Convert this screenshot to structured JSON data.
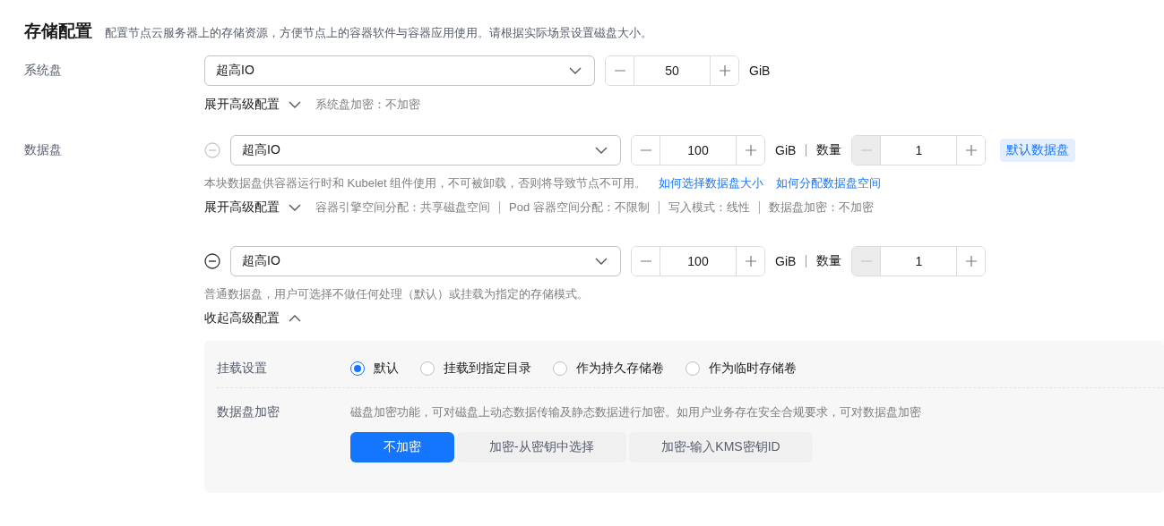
{
  "section": {
    "title": "存储配置",
    "description": "配置节点云服务器上的存储资源，方便节点上的容器软件与容器应用使用。请根据实际场景设置磁盘大小。"
  },
  "system_disk": {
    "label": "系统盘",
    "type": "超高IO",
    "size": "50",
    "unit": "GiB",
    "advanced_toggle": {
      "label": "展开高级配置",
      "expanded": false
    },
    "summary": [
      "系统盘加密：不加密"
    ]
  },
  "data_disk_label": "数据盘",
  "data_disks": [
    {
      "remove_disabled": true,
      "type": "超高IO",
      "size": "100",
      "unit": "GiB",
      "count_label": "数量",
      "count": "1",
      "decrement_disabled": true,
      "badge": "默认数据盘",
      "note": "本块数据盘供容器运行时和 Kubelet 组件使用，不可被卸载，否则将导致节点不可用。",
      "links": [
        "如何选择数据盘大小",
        "如何分配数据盘空间"
      ],
      "advanced_toggle": {
        "label": "展开高级配置",
        "expanded": false
      },
      "summary": [
        "容器引擎空间分配：共享磁盘空间",
        "Pod 容器空间分配：不限制",
        "写入模式：线性",
        "数据盘加密：不加密"
      ]
    },
    {
      "remove_disabled": false,
      "type": "超高IO",
      "size": "100",
      "unit": "GiB",
      "count_label": "数量",
      "count": "1",
      "decrement_disabled": true,
      "note": "普通数据盘，用户可选择不做任何处理（默认）或挂载为指定的存储模式。",
      "advanced_toggle": {
        "label": "收起高级配置",
        "expanded": true
      },
      "advanced": {
        "mount": {
          "label": "挂载设置",
          "options": [
            {
              "label": "默认",
              "selected": true
            },
            {
              "label": "挂载到指定目录",
              "selected": false
            },
            {
              "label": "作为持久存储卷",
              "selected": false
            },
            {
              "label": "作为临时存储卷",
              "selected": false
            }
          ]
        },
        "encryption": {
          "label": "数据盘加密",
          "description": "磁盘加密功能，可对磁盘上动态数据传输及静态数据进行加密。如用户业务存在安全合规要求，可对数据盘加密",
          "options": [
            {
              "label": "不加密",
              "selected": true
            },
            {
              "label": "加密-从密钥中选择",
              "selected": false
            },
            {
              "label": "加密-输入KMS密钥ID",
              "selected": false
            }
          ]
        }
      }
    }
  ]
}
